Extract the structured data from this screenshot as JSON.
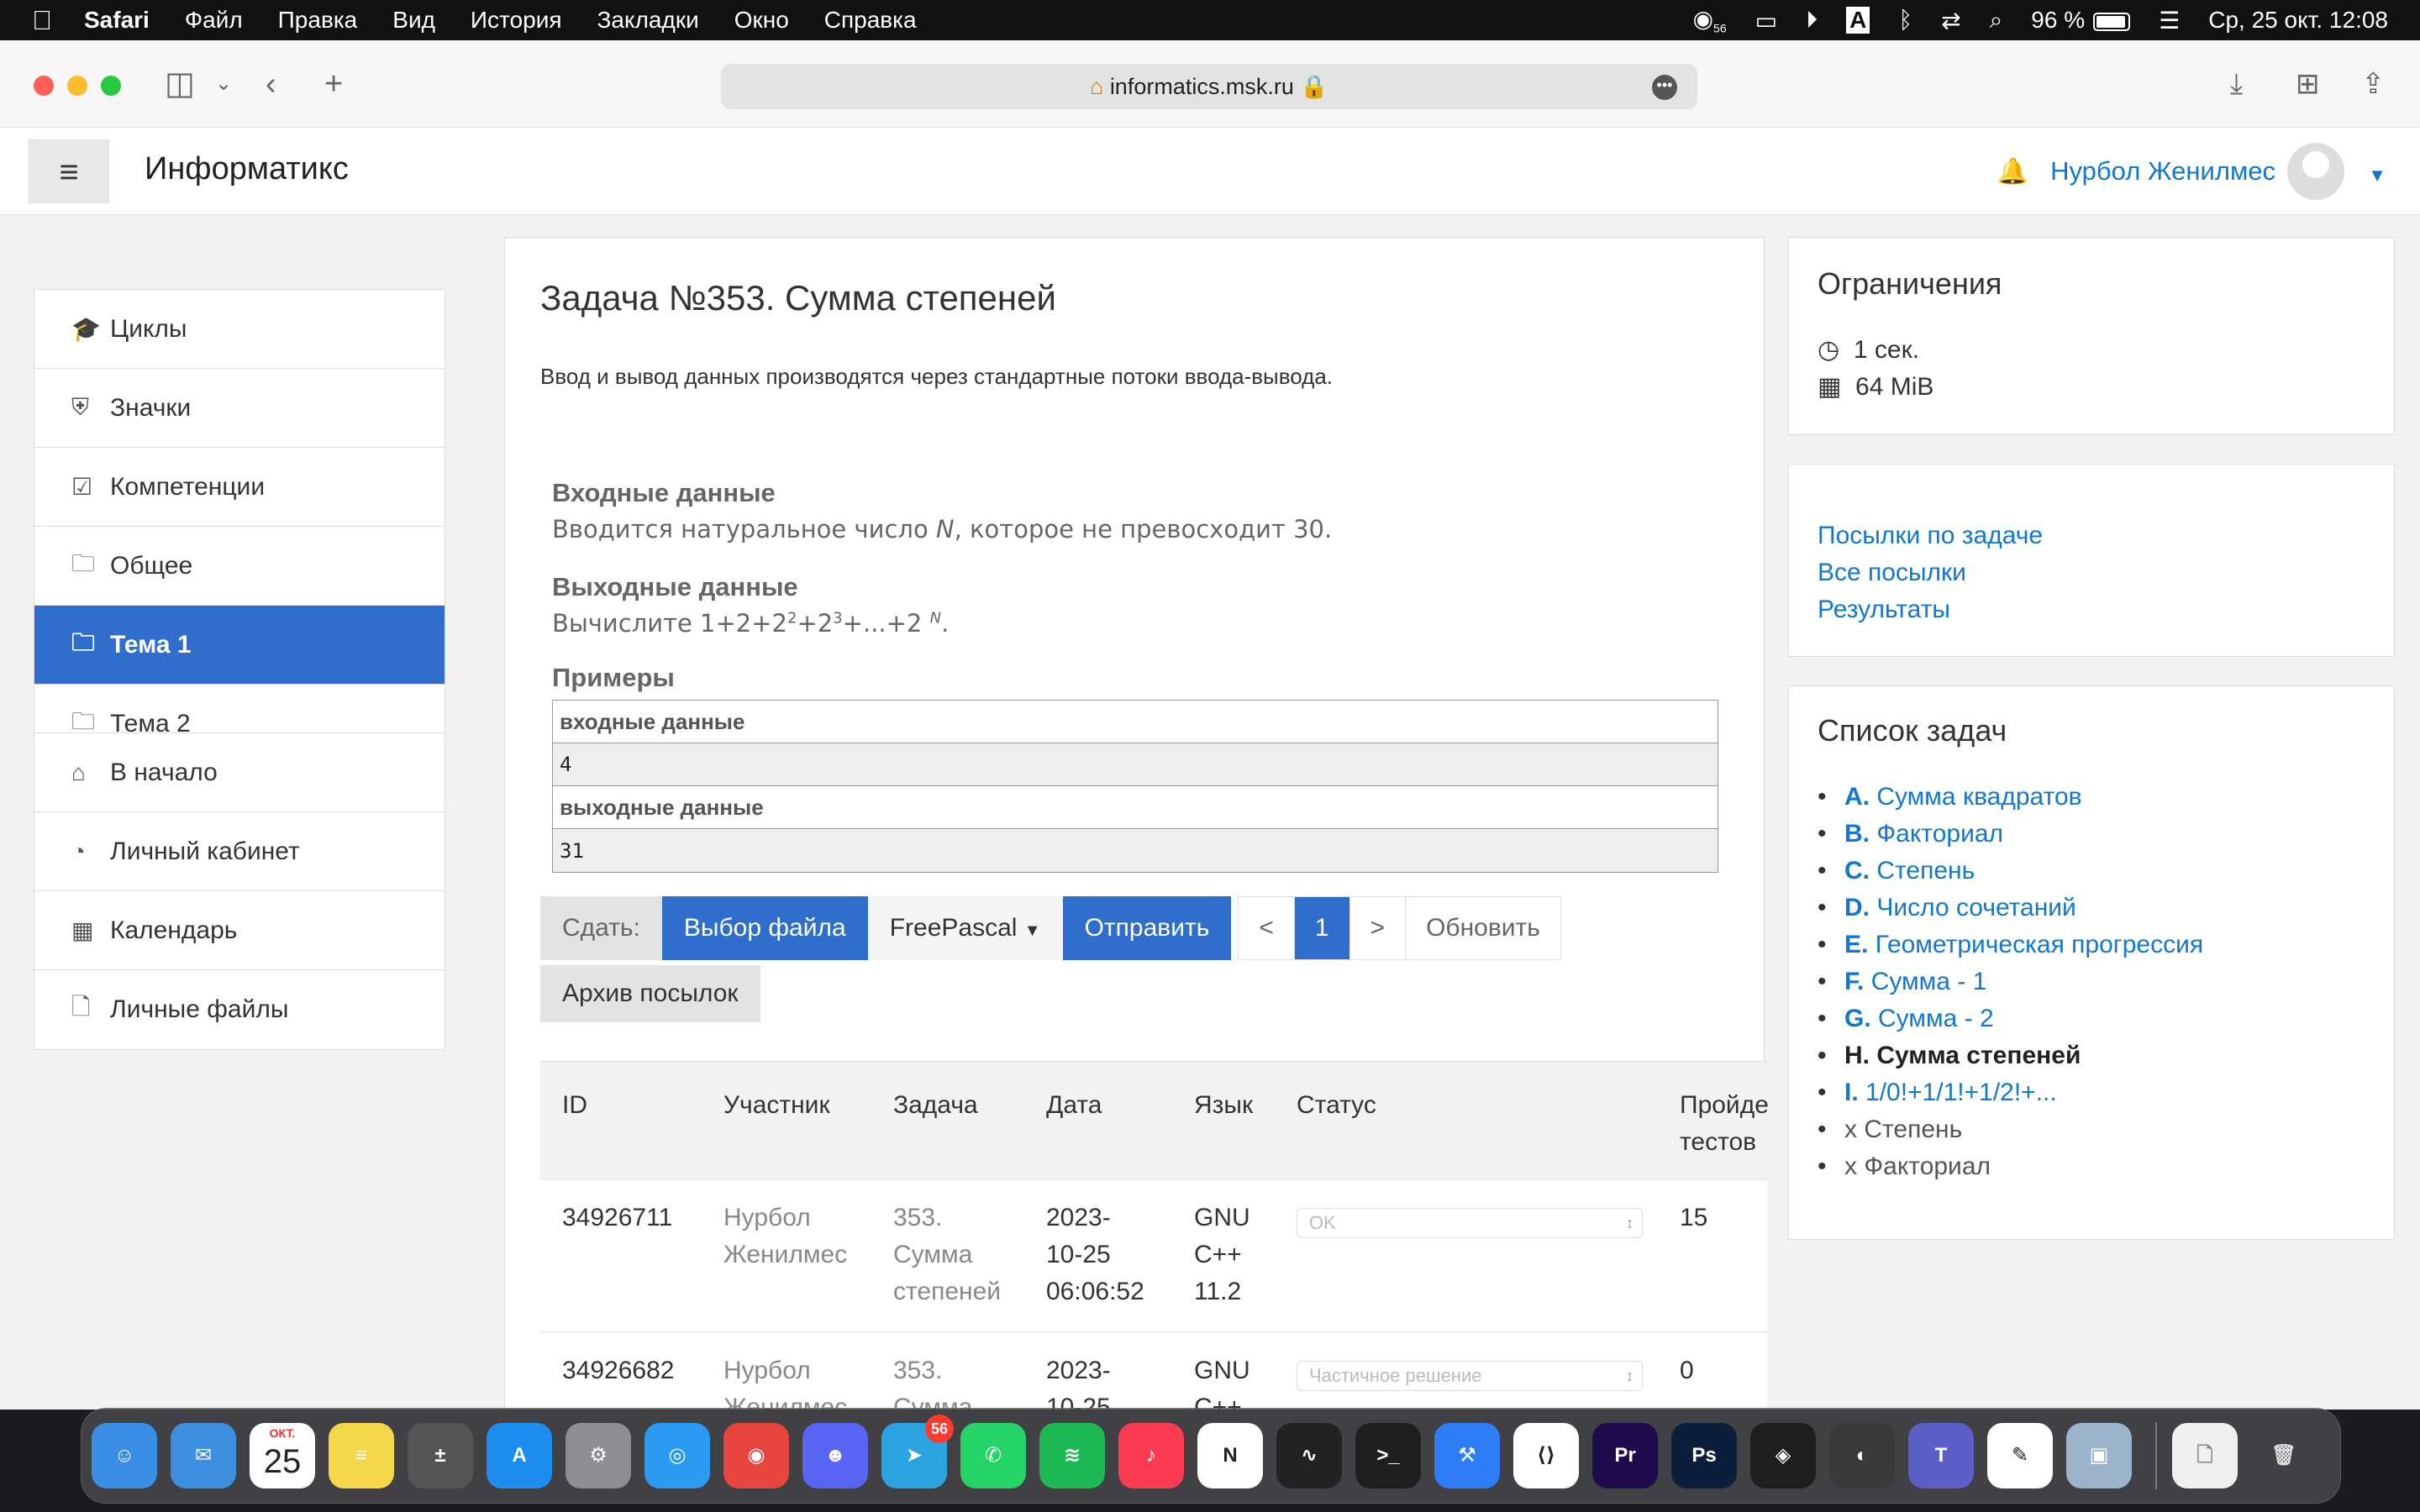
{
  "menubar": {
    "app": "Safari",
    "items": [
      "Файл",
      "Правка",
      "Вид",
      "История",
      "Закладки",
      "Окно",
      "Справка"
    ],
    "notif_count": "56",
    "input_source": "A",
    "battery": "96 %",
    "clock": "Ср, 25 окт.  12:08"
  },
  "browser": {
    "url": "informatics.msk.ru"
  },
  "site": {
    "brand": "Информатикс",
    "user_name": "Нурбол Женилмес"
  },
  "leftnav": {
    "group1": [
      {
        "icon": "graduation-cap-icon",
        "glyph": "🎓",
        "label": "Циклы"
      },
      {
        "icon": "shield-icon",
        "glyph": "⛨",
        "label": "Значки"
      },
      {
        "icon": "checkbox-icon",
        "glyph": "☑",
        "label": "Компетенции"
      },
      {
        "icon": "folder-icon",
        "glyph": "🗀",
        "label": "Общее"
      },
      {
        "icon": "folder-icon",
        "glyph": "🗀",
        "label": "Тема 1",
        "active": true
      },
      {
        "icon": "folder-icon",
        "glyph": "🗀",
        "label": "Тема 2"
      }
    ],
    "group2": [
      {
        "icon": "home-icon",
        "glyph": "⌂",
        "label": "В начало"
      },
      {
        "icon": "dashboard-icon",
        "glyph": "◔",
        "label": "Личный кабинет"
      },
      {
        "icon": "calendar-icon",
        "glyph": "▦",
        "label": "Календарь"
      },
      {
        "icon": "file-icon",
        "glyph": "🗋",
        "label": "Личные файлы"
      }
    ]
  },
  "problem": {
    "title": "Задача №353. Сумма степеней",
    "io_note": "Ввод и вывод данных производятся через стандартные потоки ввода-вывода.",
    "input_heading": "Входные данные",
    "input_text_a": "Вводится натуральное число ",
    "input_var": "N",
    "input_text_b": ", которое не превосходит 30.",
    "output_heading": "Выходные данные",
    "output_text_a": "Вычислите 1+2+2",
    "output_sup1": "2",
    "output_text_b": "+2",
    "output_sup2": "3",
    "output_text_c": "+...+2 ",
    "output_sup3": "N",
    "output_text_d": ".",
    "examples_heading": "Примеры",
    "example_input_label": "входные данные",
    "example_input": "4",
    "example_output_label": "выходные данные",
    "example_output": "31"
  },
  "submit": {
    "label": "Сдать:",
    "choose_file": "Выбор файла",
    "compiler": "FreePascal",
    "send": "Отправить",
    "prev": "<",
    "page": "1",
    "next": ">",
    "refresh": "Обновить",
    "archive": "Архив посылок"
  },
  "submissions": {
    "headers": {
      "id": "ID",
      "user": "Участник",
      "task": "Задача",
      "date": "Дата",
      "lang": "Язык",
      "status": "Статус",
      "passed_a": "Пройде",
      "passed_b": "тестов"
    },
    "rows": [
      {
        "id": "34926711",
        "user_a": "Нурбол",
        "user_b": "Женилмес",
        "task_a": "353.",
        "task_b": "Сумма",
        "task_c": "степеней",
        "date_a": "2023-",
        "date_b": "10-25",
        "date_c": "06:06:52",
        "lang_a": "GNU",
        "lang_b": "C++",
        "lang_c": "11.2",
        "status": "OK",
        "passed": "15"
      },
      {
        "id": "34926682",
        "user_a": "Нурбол",
        "user_b": "Женилмес",
        "task_a": "353.",
        "task_b": "Сумма",
        "task_c": "",
        "date_a": "2023-",
        "date_b": "10-25",
        "date_c": "",
        "lang_a": "GNU",
        "lang_b": "C++",
        "lang_c": "",
        "status": "Частичное решение",
        "passed": "0"
      }
    ]
  },
  "limits": {
    "heading": "Ограничения",
    "time": "1 сек.",
    "memory": "64 MiB"
  },
  "links": {
    "submissions": "Посылки по задаче",
    "all": "Все посылки",
    "results": "Результаты"
  },
  "tasklist": {
    "heading": "Список задач",
    "items": [
      {
        "letter": "A.",
        "name": "Сумма квадратов"
      },
      {
        "letter": "B.",
        "name": "Факториал"
      },
      {
        "letter": "C.",
        "name": "Степень"
      },
      {
        "letter": "D.",
        "name": "Число сочетаний"
      },
      {
        "letter": "E.",
        "name": "Геометрическая прогрессия"
      },
      {
        "letter": "F.",
        "name": "Сумма - 1"
      },
      {
        "letter": "G.",
        "name": "Сумма - 2"
      },
      {
        "letter": "H.",
        "name": "Сумма степеней"
      },
      {
        "letter": "I.",
        "name": "1/0!+1/1!+1/2!+..."
      },
      {
        "letter": "",
        "name": "x Степень"
      },
      {
        "letter": "",
        "name": "x Факториал"
      }
    ]
  },
  "dock": {
    "calendar_month": "ОКТ.",
    "calendar_day": "25",
    "telegram_badge": "56",
    "apps": [
      {
        "name": "finder-icon",
        "color": "#3a8ee6",
        "glyph": "☺"
      },
      {
        "name": "mail-icon",
        "color": "#3d8fe0",
        "glyph": "✉"
      },
      {
        "name": "calendar-icon",
        "color": "#ffffff",
        "glyph": ""
      },
      {
        "name": "notes-icon",
        "color": "#f7d74a",
        "glyph": "≡"
      },
      {
        "name": "calculator-icon",
        "color": "#555555",
        "glyph": "±"
      },
      {
        "name": "app-store-icon",
        "color": "#1d8ef0",
        "glyph": "A"
      },
      {
        "name": "system-settings-icon",
        "color": "#8e8e93",
        "glyph": "⚙"
      },
      {
        "name": "safari-icon",
        "color": "#2a9af3",
        "glyph": "◎"
      },
      {
        "name": "chrome-icon",
        "color": "#e8453c",
        "glyph": "◉"
      },
      {
        "name": "discord-icon",
        "color": "#5865f2",
        "glyph": "☻"
      },
      {
        "name": "telegram-icon",
        "color": "#2aa3e0",
        "glyph": "➤"
      },
      {
        "name": "whatsapp-icon",
        "color": "#25d366",
        "glyph": "✆"
      },
      {
        "name": "spotify-icon",
        "color": "#1db954",
        "glyph": "≋"
      },
      {
        "name": "music-icon",
        "color": "#fa3b52",
        "glyph": "♪"
      },
      {
        "name": "notion-icon",
        "color": "#ffffff",
        "glyph": "N"
      },
      {
        "name": "activity-monitor-icon",
        "color": "#222222",
        "glyph": "∿"
      },
      {
        "name": "terminal-icon",
        "color": "#1e1e1e",
        "glyph": ">_"
      },
      {
        "name": "xcode-icon",
        "color": "#2e7cf6",
        "glyph": "⚒"
      },
      {
        "name": "vscode-icon",
        "color": "#ffffff",
        "glyph": "⟨⟩"
      },
      {
        "name": "premiere-icon",
        "color": "#1f0a4d",
        "glyph": "Pr"
      },
      {
        "name": "photoshop-icon",
        "color": "#0b1f3a",
        "glyph": "Ps"
      },
      {
        "name": "figma-icon",
        "color": "#1e1e1e",
        "glyph": "◈"
      },
      {
        "name": "blender-icon",
        "color": "#3a3a3a",
        "glyph": "◐"
      },
      {
        "name": "teams-icon",
        "color": "#5b5fc7",
        "glyph": "T"
      },
      {
        "name": "paw-icon",
        "color": "#ffffff",
        "glyph": "✎"
      },
      {
        "name": "preview-icon",
        "color": "#9bb4cc",
        "glyph": "▣"
      }
    ]
  }
}
